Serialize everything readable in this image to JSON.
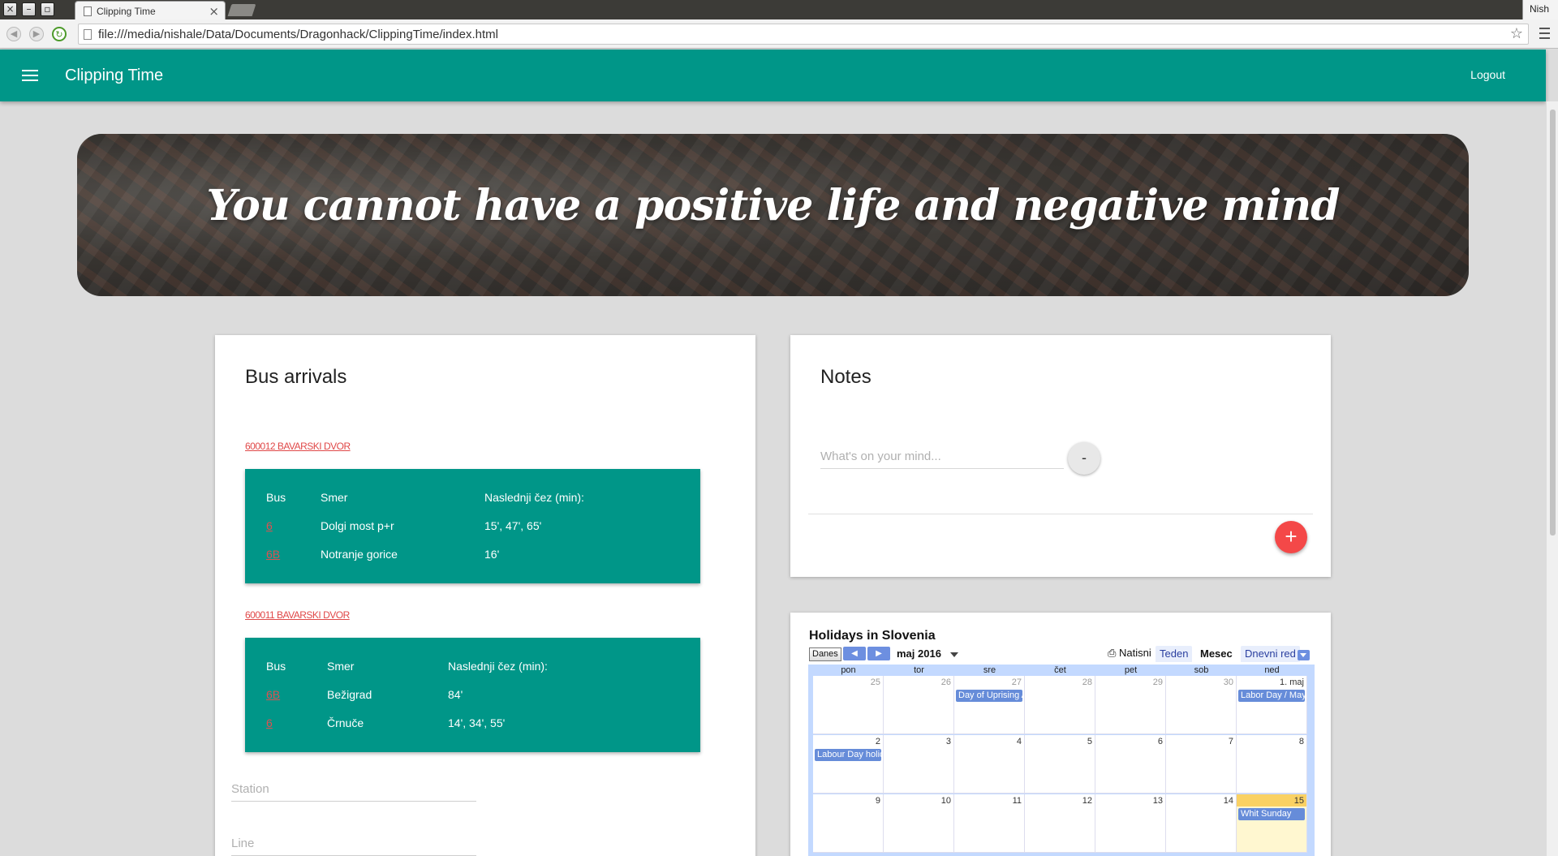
{
  "browser": {
    "tab_title": "Clipping Time",
    "url": "file:///media/nishale/Data/Documents/Dragonhack/ClippingTime/index.html",
    "user": "Nish"
  },
  "app": {
    "title": "Clipping Time",
    "logout_label": "Logout",
    "quote": "You cannot have a positive life and negative mind"
  },
  "bus": {
    "title": "Bus arrivals",
    "stations": [
      {
        "name": "600012 BAVARSKI DVOR",
        "headers": {
          "bus": "Bus",
          "dir": "Smer",
          "next": "Naslednji čez (min):"
        },
        "rows": [
          {
            "line": "6",
            "dir": "Dolgi most p+r",
            "times": "15', 47', 65'"
          },
          {
            "line": "6B",
            "dir": "Notranje gorice",
            "times": "16'"
          }
        ]
      },
      {
        "name": "600011 BAVARSKI DVOR",
        "headers": {
          "bus": "Bus",
          "dir": "Smer",
          "next": "Naslednji čez (min):"
        },
        "rows": [
          {
            "line": "6B",
            "dir": "Bežigrad",
            "times": "84'"
          },
          {
            "line": "6",
            "dir": "Črnuče",
            "times": "14', 34', 55'"
          }
        ]
      }
    ],
    "station_placeholder": "Station",
    "line_placeholder": "Line"
  },
  "notes": {
    "title": "Notes",
    "placeholder": "What's on your mind...",
    "remove_label": "-",
    "add_label": "+"
  },
  "calendar": {
    "title": "Holidays in Slovenia",
    "today_label": "Danes",
    "month": "maj 2016",
    "print_label": "Natisni",
    "views": [
      "Teden",
      "Mesec",
      "Dnevni red"
    ],
    "active_view": "Mesec",
    "days": [
      "pon",
      "tor",
      "sre",
      "čet",
      "pet",
      "sob",
      "ned"
    ],
    "weeks": [
      {
        "nums": [
          "25",
          "26",
          "27",
          "28",
          "29",
          "30",
          "1. maj"
        ],
        "dim": [
          true,
          true,
          true,
          true,
          true,
          true,
          false
        ],
        "events": {
          "2": "Day of Uprising Against Occupation",
          "6": "Labor Day / May Day"
        }
      },
      {
        "nums": [
          "2",
          "3",
          "4",
          "5",
          "6",
          "7",
          "8"
        ],
        "dim": [
          false,
          false,
          false,
          false,
          false,
          false,
          false
        ],
        "events": {
          "0": "Labour Day holiday"
        }
      },
      {
        "nums": [
          "9",
          "10",
          "11",
          "12",
          "13",
          "14",
          "15"
        ],
        "dim": [
          false,
          false,
          false,
          false,
          false,
          false,
          false
        ],
        "events": {
          "6": "Whit Sunday"
        },
        "today": 6
      }
    ]
  },
  "colors": {
    "primary": "#009688",
    "accent": "#f44848",
    "link": "#e04848",
    "calendar_event": "#668cd9"
  }
}
